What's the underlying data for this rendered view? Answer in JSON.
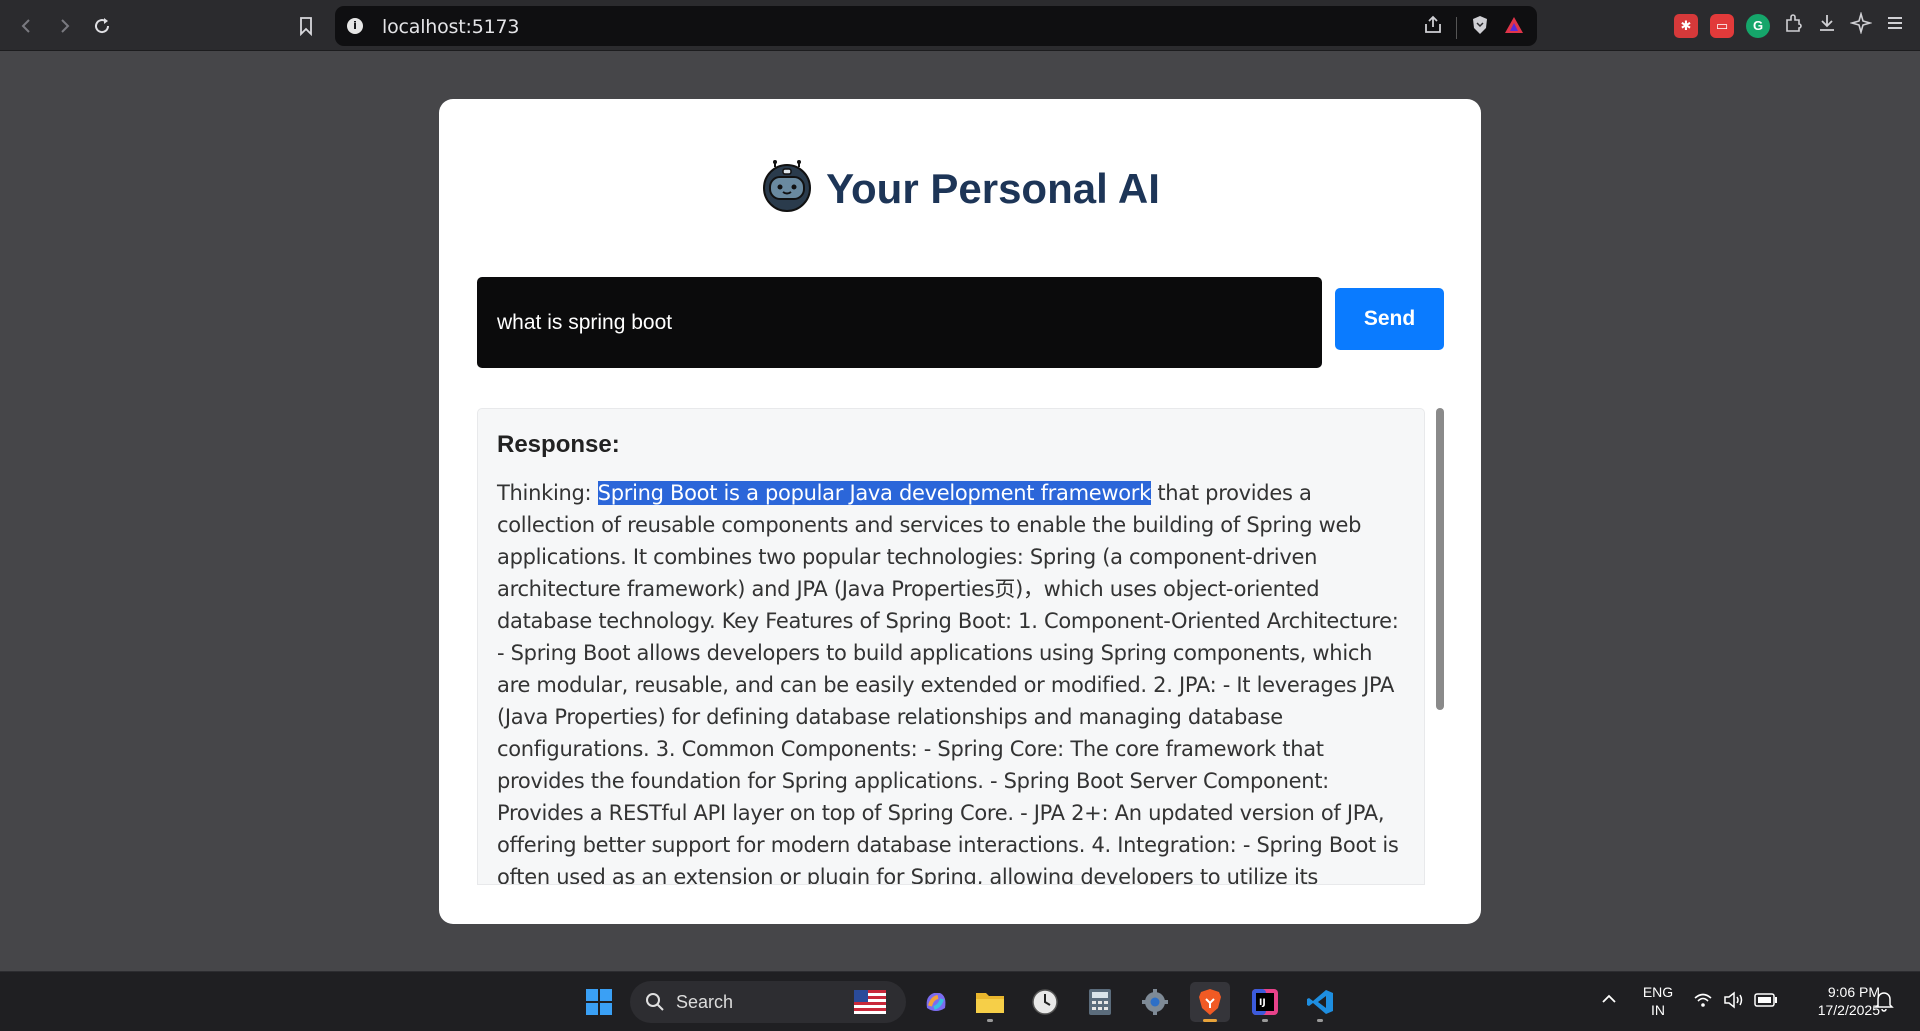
{
  "browser": {
    "url": "localhost:5173",
    "info_icon_glyph": "i"
  },
  "app": {
    "title": "Your Personal AI",
    "prompt_value": "what is spring boot",
    "send_label": "Send",
    "response_heading": "Response:",
    "response_prefix": "Thinking: ",
    "response_highlight": "Spring Boot is a popular Java development framework",
    "response_rest": " that provides a collection of reusable components and services to enable the building of Spring web applications. It combines two popular technologies: Spring (a component-driven architecture framework) and JPA (Java Properties页)，which uses object-oriented database technology. Key Features of Spring Boot: 1. Component-Oriented Architecture: - Spring Boot allows developers to build applications using Spring components, which are modular, reusable, and can be easily extended or modified. 2. JPA: - It leverages JPA (Java Properties) for defining database relationships and managing database configurations. 3. Common Components: - Spring Core: The core framework that provides the foundation for Spring applications. - Spring Boot Server Component: Provides a RESTful API layer on top of Spring Core. - JPA 2+: An updated version of JPA, offering better support for modern database interactions. 4. Integration: - Spring Boot is often used as an extension or plugin for Spring, allowing developers to utilize its features without rewriting their code from scratch. Example Use Cases: - Building RESTful web"
  },
  "taskbar": {
    "search_label": "Search",
    "language_line1": "ENG",
    "language_line2": "IN",
    "time": "9:06 PM",
    "date": "17/2/2025"
  },
  "colors": {
    "accent": "#0a7bff",
    "title": "#1d3557",
    "highlight": "#2b66d9"
  }
}
